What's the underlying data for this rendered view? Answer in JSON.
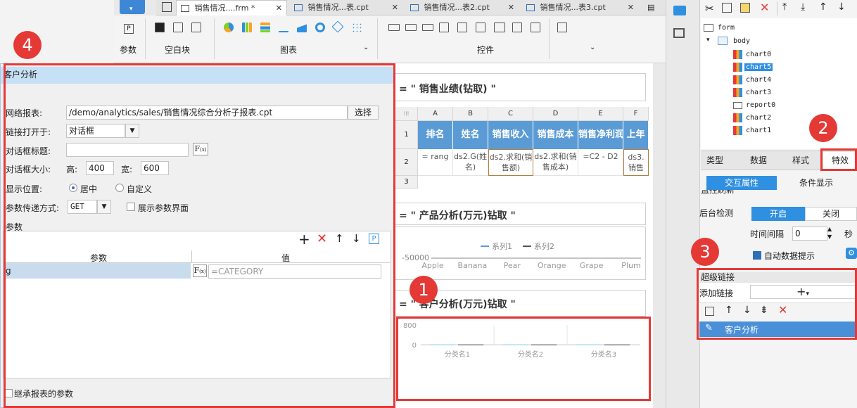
{
  "tabs": [
    {
      "label": "销售情况....frm *",
      "active": true
    },
    {
      "label": "销售情况...表.cpt",
      "active": false
    },
    {
      "label": "销售情况...表2.cpt",
      "active": false
    },
    {
      "label": "销售情况...表3.cpt",
      "active": false
    }
  ],
  "toolbar": {
    "groups": {
      "param": "参数",
      "blank": "空白块",
      "chart": "图表",
      "control": "控件"
    },
    "param_icon_letter": "P"
  },
  "canvas": {
    "sec1_title": "= \" 销售业绩(钻取) \"",
    "sheet": {
      "columns": [
        "A",
        "B",
        "C",
        "D",
        "E",
        "F"
      ],
      "rows": [
        "1",
        "2",
        "3"
      ],
      "header_row": [
        "排名",
        "姓名",
        "销售收入",
        "销售成本",
        "销售净利润",
        "上年"
      ],
      "data_row": [
        "= rang",
        "ds2.G(姓名)",
        "ds2.求和(销售额)",
        "ds2.求和(销售成本)",
        "=C2 - D2",
        "ds3. 销售"
      ]
    },
    "sec2_title": "= \" 产品分析(万元)钻取 \"",
    "sec3_title": "= \" 客户分析(万元)钻取 \""
  },
  "chart_data": [
    {
      "type": "line",
      "categories": [
        "Apple",
        "Banana",
        "Pear",
        "Orange",
        "Grape",
        "Plum"
      ],
      "series": [
        {
          "name": "系列1",
          "values": []
        },
        {
          "name": "系列2",
          "values": []
        }
      ],
      "title": "",
      "ytick": "-50000",
      "legend": "top"
    },
    {
      "type": "bar",
      "categories": [
        "分类名1",
        "分类名2",
        "分类名3"
      ],
      "yticks": [
        "800",
        "0"
      ],
      "ylim": [
        0,
        800
      ],
      "series": [
        {
          "values": [
            15,
            15,
            15
          ]
        },
        {
          "values": [
            10,
            10,
            10
          ]
        }
      ],
      "title": ""
    }
  ],
  "tree": {
    "root": "form",
    "body": "body",
    "items": [
      {
        "name": "chart0",
        "selected": false
      },
      {
        "name": "chart5",
        "selected": true
      },
      {
        "name": "chart4",
        "selected": false
      },
      {
        "name": "chart3",
        "selected": false
      },
      {
        "name": "report0",
        "selected": false
      },
      {
        "name": "chart2",
        "selected": false
      },
      {
        "name": "chart1",
        "selected": false
      }
    ]
  },
  "panel": {
    "tabs": [
      "类型",
      "数据",
      "样式",
      "特效"
    ],
    "subtabs": [
      "交互属性",
      "条件显示"
    ],
    "cut_text": "监控刷新",
    "backend_check_label": "后台检测",
    "on": "开启",
    "off": "关闭",
    "interval_label": "时间间隔",
    "interval_value": "0",
    "interval_unit": "秒",
    "auto_hint": "自动数据提示",
    "hyperlink_title": "超级链接",
    "add_link_label": "添加链接",
    "link_item": "客户分析"
  },
  "dialog": {
    "title": "客户分析",
    "report_label": "网络报表:",
    "report_path": "/demo/analytics/sales/销售情况综合分析子报表.cpt",
    "select_btn": "选择",
    "open_in_label": "链接打开于:",
    "open_in_value": "对话框",
    "dlg_title_label": "对话框标题:",
    "dlg_title_value": "",
    "dlg_size_label": "对话框大小:",
    "height_label": "高:",
    "height_value": "400",
    "width_label": "宽:",
    "width_value": "600",
    "position_label": "显示位置:",
    "pos_center": "居中",
    "pos_custom": "自定义",
    "param_pass_label": "参数传递方式:",
    "param_pass_value": "GET",
    "show_param_ui": "展示参数界面",
    "params_group": "参数",
    "table_col_param": "参数",
    "table_col_value": "值",
    "param_name": "g",
    "param_value": "=CATEGORY",
    "inherit": "继承报表的参数"
  },
  "annotations": [
    "1",
    "2",
    "3",
    "4"
  ],
  "colors": {
    "accent": "#2f8fe0",
    "annotation": "#e53935",
    "header_blue": "#5b9bd5",
    "selected_row": "#4a90d9"
  }
}
